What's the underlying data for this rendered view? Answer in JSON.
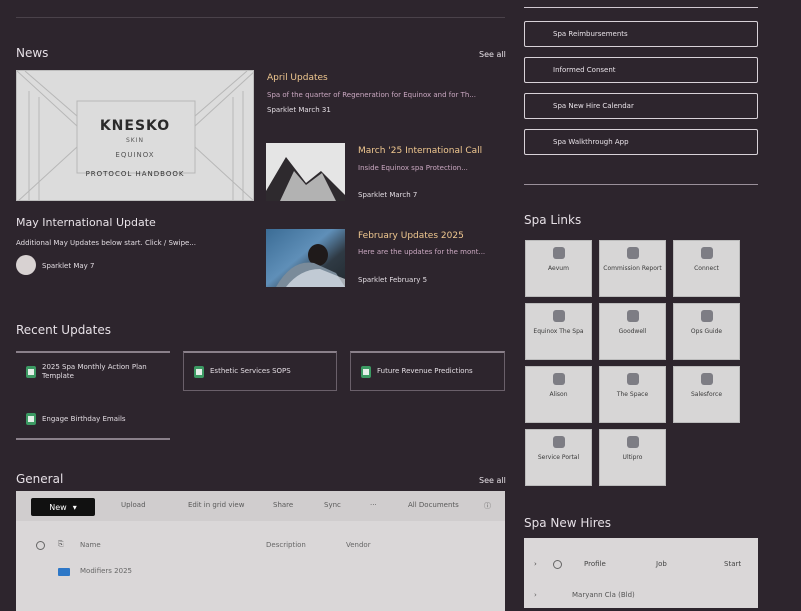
{
  "news": {
    "title": "News",
    "see_all": "See all",
    "hero": {
      "brand": "KNESKO",
      "brand_sub": "SKIN",
      "sub": "EQUINOX",
      "title": "PROTOCOL HANDBOOK"
    },
    "featured": {
      "title": "May International Update",
      "desc": "Additional May Updates below start. Click / Swipe...",
      "author": "Sparklet May 7"
    },
    "items": [
      {
        "title": "April Updates",
        "desc": "Spa of the quarter of Regeneration for Equinox and for Th...",
        "meta": "Sparklet March 31"
      },
      {
        "title": "March '25 International Call",
        "desc": "Inside Equinox spa Protection...",
        "meta": "Sparklet March 7"
      },
      {
        "title": "February Updates 2025",
        "desc": "Here are the updates for the mont...",
        "meta": "Sparklet February 5"
      }
    ]
  },
  "recent_updates": {
    "title": "Recent Updates",
    "cards": [
      "2025 Spa Monthly Action Plan Template",
      "Esthetic Services SOPS",
      "Future Revenue Predictions",
      "Engage Birthday Emails"
    ]
  },
  "general": {
    "title": "General",
    "see_all": "See all",
    "toolbar": {
      "new": "New",
      "upload": "Upload",
      "edit_grid": "Edit in grid view",
      "share": "Share",
      "sync": "Sync",
      "more": "···",
      "view": "All Documents"
    },
    "columns": [
      "Name",
      "Description",
      "Vendor"
    ],
    "rows": [
      "Modifiers 2025"
    ]
  },
  "right_buttons": [
    "Spa Reimbursements",
    "Informed Consent",
    "Spa New Hire Calendar",
    "Spa Walkthrough App"
  ],
  "spa_links": {
    "title": "Spa Links",
    "tiles": [
      "Aevum",
      "Commission Report",
      "Connect",
      "Equinox The Spa",
      "Goodwell",
      "Ops Guide",
      "Alison",
      "The Space",
      "Salesforce",
      "Service Portal",
      "Ultipro"
    ]
  },
  "spa_new_hires": {
    "title": "Spa New Hires",
    "columns": [
      "Profile",
      "Job",
      "Start"
    ],
    "rows": [
      "Maryann Cla (Bld)"
    ]
  }
}
